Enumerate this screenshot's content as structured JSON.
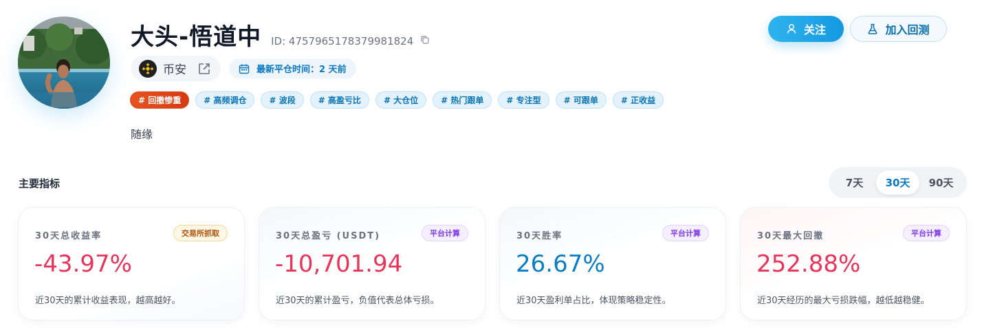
{
  "profile": {
    "name": "大头-悟道中",
    "id_text": "ID: 4757965178379981824",
    "motto": "随缘"
  },
  "exchange": {
    "name": "币安",
    "logo_icon": "binance-logo",
    "link_icon": "external-link-icon"
  },
  "last_close": {
    "icon": "calendar-icon",
    "text": "最新平仓时间：2 天前"
  },
  "tags": [
    {
      "label": "# 回撤惨重",
      "style": "hot"
    },
    {
      "label": "# 高频调仓",
      "style": "normal"
    },
    {
      "label": "# 波段",
      "style": "normal"
    },
    {
      "label": "# 高盈亏比",
      "style": "normal"
    },
    {
      "label": "# 大仓位",
      "style": "normal"
    },
    {
      "label": "# 热门跟单",
      "style": "normal"
    },
    {
      "label": "# 专注型",
      "style": "normal"
    },
    {
      "label": "# 可跟单",
      "style": "normal"
    },
    {
      "label": "# 正收益",
      "style": "normal"
    }
  ],
  "actions": {
    "follow_label": "关注",
    "backtest_label": "加入回测"
  },
  "metrics_section": {
    "title": "主要指标",
    "ranges": [
      "7天",
      "30天",
      "90天"
    ],
    "active_range": "30天"
  },
  "cards": [
    {
      "label": "30天总收益率",
      "badge": "交易所抓取",
      "value": "-43.97%",
      "desc": "近30天的累计收益表现，越高越好。"
    },
    {
      "label": "30天总盈亏 (USDT)",
      "badge": "平台计算",
      "value": "-10,701.94",
      "desc": "近30天的累计盈亏，负值代表总体亏损。"
    },
    {
      "label": "30天胜率",
      "badge": "平台计算",
      "value": "26.67%",
      "desc": "近30天盈利单占比，体现策略稳定性。"
    },
    {
      "label": "30天最大回撤",
      "badge": "平台计算",
      "value": "252.88%",
      "desc": "近30天经历的最大亏损跌幅，越低越稳健。"
    }
  ],
  "colors": {
    "accent": "#1599e0",
    "negative": "#e8345a",
    "positive_blue": "#0b7ec2",
    "hot_tag": "#e8521f"
  }
}
